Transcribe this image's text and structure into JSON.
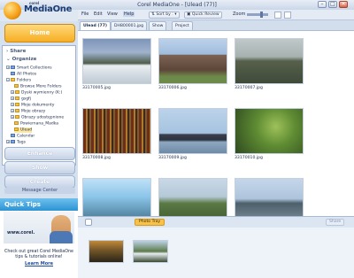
{
  "window": {
    "title": "Corel MediaOne - [Ulead (77)]"
  },
  "logo": {
    "brand_small": "corel",
    "name": "MediaOne"
  },
  "left": {
    "home": "Home",
    "share": "Share",
    "organize": "Organize",
    "tree": [
      "Smart Collections",
      "All Photos",
      "Folders",
      "Browse More Folders",
      "Dyski wymienny (K:)",
      "gsgfj",
      "Moje dokumenty",
      "Moje obrazy",
      "Obrazy udostępnione",
      "Powiernana_Madka",
      "Ulead",
      "Calendar",
      "Tags"
    ],
    "enhance": "Enhance",
    "show": "Show",
    "create": "Create",
    "message_center": "Message Center"
  },
  "quicktips": {
    "title": "Quick Tips",
    "brand": "www.corel.",
    "text": "Check out great Corel MediaOne tips & tutorials online!",
    "link": "Learn More"
  },
  "menu": [
    "File",
    "Edit",
    "View",
    "Help"
  ],
  "toolbar": {
    "sort": "Sort by :",
    "review": "Quick Review",
    "zoom": "Zoom"
  },
  "tabs": [
    "Ulead (77)",
    "DH800001.jpg",
    "Show",
    "Project"
  ],
  "grid": {
    "captions": [
      "33170005.jpg",
      "33170006.jpg",
      "33170007.jpg",
      "33170008.jpg",
      "33170009.jpg",
      "33170010.jpg"
    ]
  },
  "tray": {
    "label": "Photo Tray",
    "share": "Share"
  },
  "colors": {
    "accent": "#f6ae24",
    "title": "#1a3b74",
    "tips": "#2c93d4"
  }
}
